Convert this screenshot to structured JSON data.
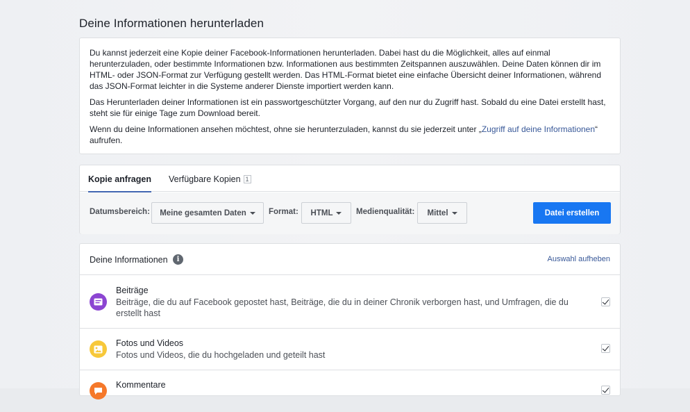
{
  "page": {
    "heading": "Deine Informationen herunterladen"
  },
  "intro": {
    "p1": "Du kannst jederzeit eine Kopie deiner Facebook-Informationen herunterladen. Dabei hast du die Möglichkeit, alles auf einmal herunterzuladen, oder bestimmte Informationen bzw. Informationen aus bestimmten Zeitspannen auszuwählen. Deine Daten können dir im HTML- oder JSON-Format zur Verfügung gestellt werden. Das HTML-Format bietet eine einfache Übersicht deiner Informationen, während das JSON-Format leichter in die Systeme anderer Dienste importiert werden kann.",
    "p2": "Das Herunterladen deiner Informationen ist ein passwortgeschützter Vorgang, auf den nur du Zugriff hast. Sobald du eine Datei erstellt hast, steht sie für einige Tage zum Download bereit.",
    "p3_before": "Wenn du deine Informationen ansehen möchtest, ohne sie herunterzuladen, kannst du sie jederzeit unter „",
    "p3_link": "Zugriff auf deine Informationen",
    "p3_after": "“ aufrufen."
  },
  "tabs": {
    "request": "Kopie anfragen",
    "available": "Verfügbare Kopien",
    "available_count": "1"
  },
  "filters": {
    "date_label": "Datumsbereich:",
    "date_value": "Meine gesamten Daten",
    "format_label": "Format:",
    "format_value": "HTML",
    "quality_label": "Medienqualität:",
    "quality_value": "Mittel",
    "create_button": "Datei erstellen"
  },
  "info": {
    "title": "Deine Informationen",
    "info_icon": "i",
    "deselect": "Auswahl aufheben",
    "items": [
      {
        "title": "Beiträge",
        "description": "Beiträge, die du auf Facebook gepostet hast, Beiträge, die du in deiner Chronik verborgen hast, und Umfragen, die du erstellt hast",
        "icon": "posts-icon",
        "color": "#8c45d2",
        "checked": true
      },
      {
        "title": "Fotos und Videos",
        "description": "Fotos und Videos, die du hochgeladen und geteilt hast",
        "icon": "photos-icon",
        "color": "#f7c83a",
        "checked": true
      },
      {
        "title": "Kommentare",
        "description": "",
        "icon": "comments-icon",
        "color": "#f5782a",
        "checked": true
      }
    ]
  },
  "colors": {
    "primary_button": "#1877f2",
    "link": "#385898",
    "tab_underline": "#4267b2"
  }
}
